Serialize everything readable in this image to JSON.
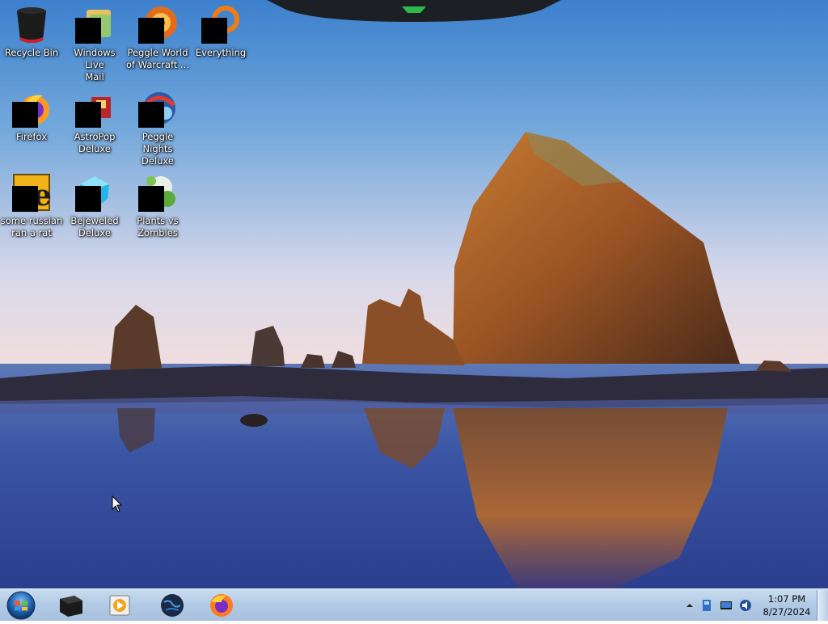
{
  "desktop": {
    "icons": [
      {
        "name": "recycle-bin",
        "label": "Recycle Bin"
      },
      {
        "name": "windows-live-mail",
        "label": "Windows Live\nMail"
      },
      {
        "name": "peggle-world-of-warcraft",
        "label": "Peggle World\nof Warcraft ..."
      },
      {
        "name": "everything",
        "label": "Everything"
      },
      {
        "name": "firefox",
        "label": "Firefox"
      },
      {
        "name": "astropop-deluxe",
        "label": "AstroPop\nDeluxe"
      },
      {
        "name": "peggle-nights-deluxe",
        "label": "Peggle Nights\nDeluxe"
      },
      {
        "name": "some-russian-ran-a-rat",
        "label": "some russian\nran a rat"
      },
      {
        "name": "bejeweled-deluxe",
        "label": "Bejeweled\nDeluxe"
      },
      {
        "name": "plants-vs-zombies",
        "label": "Plants vs\nZombies"
      }
    ]
  },
  "taskbar": {
    "start_icon": "windows-orb-icon",
    "pinned": [
      {
        "name": "cube-app-icon"
      },
      {
        "name": "media-player-icon"
      },
      {
        "name": "globe-browser-icon"
      },
      {
        "name": "firefox-icon"
      }
    ],
    "tray": {
      "overflow_icon": "chevron-up-icon",
      "icons": [
        "action-center-icon",
        "network-icon",
        "volume-icon"
      ]
    },
    "clock": {
      "time": "1:07 PM",
      "date": "8/27/2024"
    }
  }
}
